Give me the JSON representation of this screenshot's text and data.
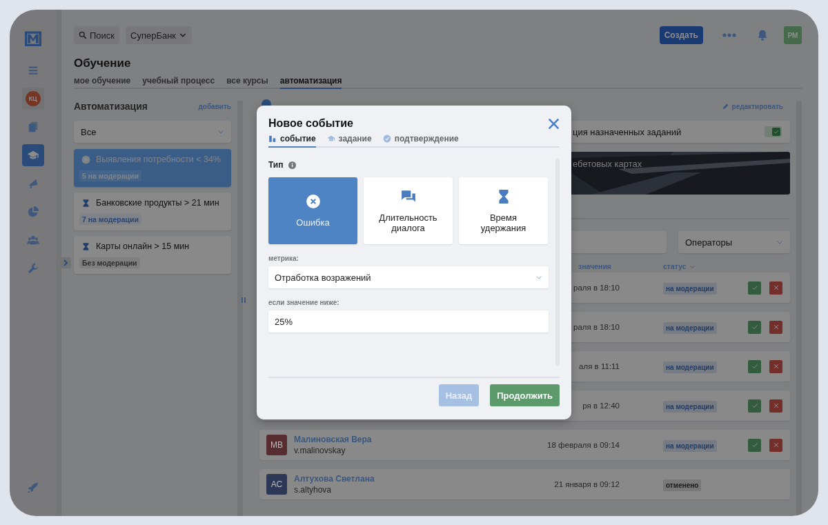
{
  "sidebar": {
    "items": [
      {
        "kind": "menu",
        "selected": false
      },
      {
        "kind": "avatar",
        "initials": "КЦ",
        "selected": false
      },
      {
        "kind": "library",
        "selected": false
      },
      {
        "kind": "courses",
        "selected": true
      },
      {
        "kind": "megaphone",
        "selected": false
      },
      {
        "kind": "reports",
        "selected": false
      },
      {
        "kind": "people",
        "selected": false
      },
      {
        "kind": "tools",
        "selected": false
      }
    ]
  },
  "topbar": {
    "search": "Поиск",
    "company": "СуперБанк",
    "create": "Создать",
    "user_initials": "РМ"
  },
  "page_title": "Обучение",
  "tabs": [
    {
      "label": "мое обучение",
      "selected": false
    },
    {
      "label": "учебный процесс",
      "selected": false
    },
    {
      "label": "все курсы",
      "selected": false
    },
    {
      "label": "автоматизация",
      "selected": true
    }
  ],
  "automation": {
    "title": "Автоматизация",
    "add_link": "добавить",
    "filter": "Все",
    "rules": [
      {
        "kind": "error",
        "title": "Выявления потребности < 34%",
        "badge": "5 на модерации",
        "moderated": true,
        "selected": true
      },
      {
        "kind": "time",
        "title": "Банковские продукты > 21 мин",
        "badge": "7 на модерации",
        "moderated": true,
        "selected": false
      },
      {
        "kind": "time",
        "title": "Карты онлайн > 15 мин",
        "badge": "Без модерации",
        "moderated": false,
        "selected": false
      }
    ]
  },
  "detail": {
    "edit_link": "редактировать",
    "setting_label": "ция назначенных заданий",
    "setting_checked": true,
    "banner_text": "ебетовых картах",
    "operators_filter": "Операторы",
    "columns": [
      "значения",
      "статус"
    ],
    "rows": [
      {
        "date": "раля в 18:10",
        "status": "на модерации",
        "cancelled": false,
        "actions": true
      },
      {
        "date": "раля в 18:10",
        "status": "на модерации",
        "cancelled": false,
        "actions": true
      },
      {
        "date": "аля в 11:11",
        "status": "на модерации",
        "cancelled": false,
        "actions": true
      },
      {
        "date": "ря в 12:40",
        "status": "на модерации",
        "cancelled": false,
        "actions": true
      },
      {
        "initials": "МВ",
        "color": "#582d31",
        "name": "Малиновская Вера",
        "login": "v.malinovskay",
        "date": "18 февраля в 09:14",
        "status": "на модерации",
        "cancelled": false,
        "actions": true
      },
      {
        "initials": "АС",
        "color": "#2d3856",
        "name": "Алтухова Светлана",
        "login": "s.altyhova",
        "date": "21 января в 09:12",
        "status": "отменено",
        "cancelled": true,
        "actions": false
      }
    ]
  },
  "modal": {
    "title": "Новое событие",
    "tabs": [
      {
        "kind": "event",
        "label": "событие",
        "selected": true
      },
      {
        "kind": "task",
        "label": "задание",
        "selected": false
      },
      {
        "kind": "confirm",
        "label": "подтверждение",
        "selected": false
      }
    ],
    "type_label": "Тип",
    "types": [
      {
        "kind": "error",
        "label": "Ошибка",
        "selected": true
      },
      {
        "kind": "dialog",
        "label": "Длительность диалога",
        "selected": false
      },
      {
        "kind": "time",
        "label": "Время удержания",
        "selected": false
      }
    ],
    "metric_label": "метрика:",
    "metric_value": "Отработка возражений",
    "threshold_label": "если значение ниже:",
    "threshold_value": "25%",
    "back_button": {
      "label": "Назад",
      "disabled": true
    },
    "continue_button": {
      "label": "Продолжить",
      "disabled": false
    }
  }
}
